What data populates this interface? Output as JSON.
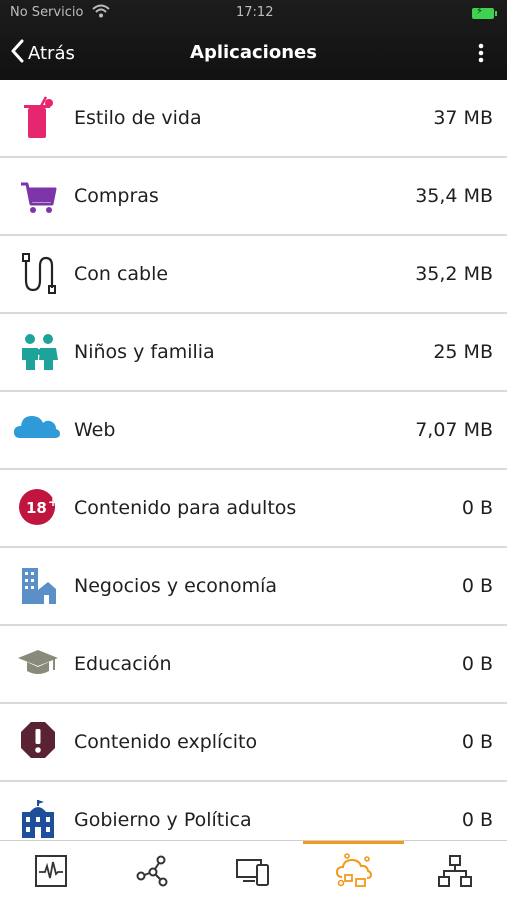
{
  "status_bar": {
    "carrier": "No Servicio",
    "time": "17:12",
    "battery_label": "⚡"
  },
  "nav": {
    "back_label": "Atrás",
    "title": "Aplicaciones"
  },
  "categories": [
    {
      "label": "Estilo de vida",
      "size": "37 MB",
      "icon": "cocktail-icon"
    },
    {
      "label": "Compras",
      "size": "35,4 MB",
      "icon": "shopping-cart-icon"
    },
    {
      "label": "Con cable",
      "size": "35,2 MB",
      "icon": "cable-icon"
    },
    {
      "label": "Niños y familia",
      "size": "25 MB",
      "icon": "family-icon"
    },
    {
      "label": "Web",
      "size": "7,07 MB",
      "icon": "cloud-icon"
    },
    {
      "label": "Contenido para adultos",
      "size": "0 B",
      "icon": "adult-18-icon"
    },
    {
      "label": "Negocios y economía",
      "size": "0 B",
      "icon": "buildings-icon"
    },
    {
      "label": "Educación",
      "size": "0 B",
      "icon": "graduation-cap-icon"
    },
    {
      "label": "Contenido explícito",
      "size": "0 B",
      "icon": "warning-octagon-icon"
    },
    {
      "label": "Gobierno y Política",
      "size": "0 B",
      "icon": "government-building-icon"
    }
  ],
  "tabs": [
    {
      "icon": "activity-monitor-icon",
      "active": false
    },
    {
      "icon": "network-nodes-icon",
      "active": false
    },
    {
      "icon": "devices-icon",
      "active": false
    },
    {
      "icon": "cloud-apps-icon",
      "active": true
    },
    {
      "icon": "topology-icon",
      "active": false
    }
  ],
  "colors": {
    "accent": "#f39a1b",
    "header_bg": "#111111",
    "divider": "#d9d9d9"
  }
}
